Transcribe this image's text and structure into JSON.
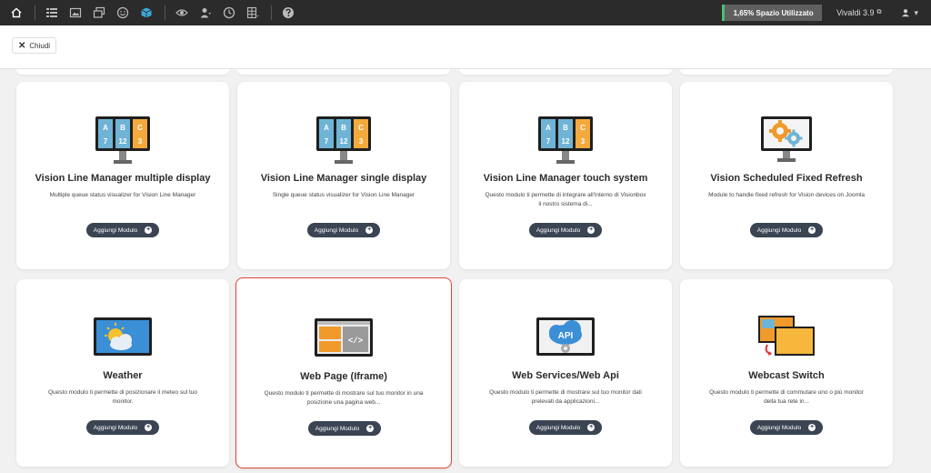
{
  "topbar": {
    "icons": [
      "home-icon",
      "list-icon",
      "image-icon",
      "windows-icon",
      "smile-icon",
      "box-icon",
      "eye-icon",
      "users-icon",
      "clock-icon",
      "grid-icon",
      "help-icon"
    ],
    "usage_label": "1,65% Spazio Utilizzato",
    "usage_accent": "#4bbf73",
    "version_label": "Vivaldi 3.9",
    "user_caret": "▾"
  },
  "header": {
    "close_label": "Chiudi"
  },
  "accent": {
    "selected_border": "#e0483a",
    "button_bg": "#3a4452"
  },
  "modules": [
    {
      "title": "Vision Line Manager multiple display",
      "desc": "Multiple queue status visualizer for Vision Line Manager",
      "button": "Aggiungi Modulo",
      "icon": "queue-monitor-icon",
      "selected": false
    },
    {
      "title": "Vision Line Manager single display",
      "desc": "Single queue status visualizer for Vision Line Manager",
      "button": "Aggiungi Modulo",
      "icon": "queue-monitor-icon",
      "selected": false
    },
    {
      "title": "Vision Line Manager touch system",
      "desc": "Questo modulo ti permette di integrare all'interno di Visionbox il nostro sistema di...",
      "button": "Aggiungi Modulo",
      "icon": "queue-monitor-icon",
      "selected": false
    },
    {
      "title": "Vision Scheduled Fixed Refresh",
      "desc": "Module to handle fixed refresh for Vision devices on Joomla",
      "button": "Aggiungi Modulo",
      "icon": "gears-monitor-icon",
      "selected": false
    },
    {
      "title": "Weather",
      "desc": "Questo modulo ti permette di posizionare il meteo sul tuo monitor.",
      "button": "Aggiungi Modulo",
      "icon": "weather-monitor-icon",
      "selected": false
    },
    {
      "title": "Web Page (Iframe)",
      "desc": "Questo modulo ti permette di mostrare sul tuo monitor in una posizione una pagina web...",
      "button": "Aggiungi Modulo",
      "icon": "webpage-monitor-icon",
      "selected": true
    },
    {
      "title": "Web Services/Web Api",
      "desc": "Questo modulo ti permette di mostrare sul tuo monitor dati prelevati da applicazioni...",
      "button": "Aggiungi Modulo",
      "icon": "api-monitor-icon",
      "selected": false
    },
    {
      "title": "Webcast Switch",
      "desc": "Questo modulo ti permette di commutare uno o più monitor della tua rete in...",
      "button": "Aggiungi Modulo",
      "icon": "webcast-switch-icon",
      "selected": false
    }
  ],
  "queue_icon": {
    "letters": [
      "A",
      "B",
      "C"
    ],
    "numbers": [
      "7",
      "12",
      "3"
    ]
  },
  "api_icon": {
    "label": "API"
  },
  "webpage_icon": {
    "code": "</>"
  }
}
